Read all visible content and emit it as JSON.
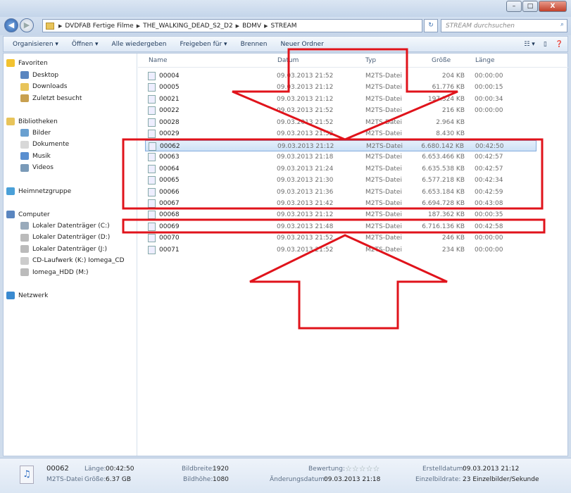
{
  "window": {
    "minimize": "–",
    "maximize": "□",
    "close": "X"
  },
  "address": {
    "crumbs": [
      "DVDFAB Fertige Filme",
      "THE_WALKING_DEAD_S2_D2",
      "BDMV",
      "STREAM"
    ],
    "search_placeholder": "STREAM durchsuchen"
  },
  "toolbar": {
    "organize": "Organisieren ▾",
    "open": "Öffnen ▾",
    "play_all": "Alle wiedergeben",
    "share": "Freigeben für ▾",
    "burn": "Brennen",
    "new_folder": "Neuer Ordner"
  },
  "sidebar": {
    "favorites": "Favoriten",
    "fav_items": [
      "Desktop",
      "Downloads",
      "Zuletzt besucht"
    ],
    "libraries": "Bibliotheken",
    "lib_items": [
      "Bilder",
      "Dokumente",
      "Musik",
      "Videos"
    ],
    "homegroup": "Heimnetzgruppe",
    "computer": "Computer",
    "drives": [
      "Lokaler Datenträger (C:)",
      "Lokaler Datenträger (D:)",
      "Lokaler Datenträger (J:)",
      "CD-Laufwerk (K:) Iomega_CD",
      "Iomega_HDD (M:)"
    ],
    "network": "Netzwerk"
  },
  "columns": [
    "Name",
    "Datum",
    "Typ",
    "Größe",
    "Länge"
  ],
  "files": [
    {
      "name": "00004",
      "date": "09.03.2013 21:52",
      "type": "M2TS-Datei",
      "size": "204 KB",
      "length": "00:00:00"
    },
    {
      "name": "00005",
      "date": "09.03.2013 21:12",
      "type": "M2TS-Datei",
      "size": "61.776 KB",
      "length": "00:00:15"
    },
    {
      "name": "00021",
      "date": "09.03.2013 21:12",
      "type": "M2TS-Datei",
      "size": "197.324 KB",
      "length": "00:00:34"
    },
    {
      "name": "00022",
      "date": "09.03.2013 21:52",
      "type": "M2TS-Datei",
      "size": "216 KB",
      "length": "00:00:00"
    },
    {
      "name": "00028",
      "date": "09.03.2013 21:52",
      "type": "M2TS-Datei",
      "size": "2.964 KB",
      "length": ""
    },
    {
      "name": "00029",
      "date": "09.03.2013 21:52",
      "type": "M2TS-Datei",
      "size": "8.430 KB",
      "length": ""
    },
    {
      "name": "00062",
      "date": "09.03.2013 21:12",
      "type": "M2TS-Datei",
      "size": "6.680.142 KB",
      "length": "00:42:50",
      "selected": true
    },
    {
      "name": "00063",
      "date": "09.03.2013 21:18",
      "type": "M2TS-Datei",
      "size": "6.653.466 KB",
      "length": "00:42:57"
    },
    {
      "name": "00064",
      "date": "09.03.2013 21:24",
      "type": "M2TS-Datei",
      "size": "6.635.538 KB",
      "length": "00:42:57"
    },
    {
      "name": "00065",
      "date": "09.03.2013 21:30",
      "type": "M2TS-Datei",
      "size": "6.577.218 KB",
      "length": "00:42:34"
    },
    {
      "name": "00066",
      "date": "09.03.2013 21:36",
      "type": "M2TS-Datei",
      "size": "6.653.184 KB",
      "length": "00:42:59"
    },
    {
      "name": "00067",
      "date": "09.03.2013 21:42",
      "type": "M2TS-Datei",
      "size": "6.694.728 KB",
      "length": "00:43:08"
    },
    {
      "name": "00068",
      "date": "09.03.2013 21:12",
      "type": "M2TS-Datei",
      "size": "187.362 KB",
      "length": "00:00:35"
    },
    {
      "name": "00069",
      "date": "09.03.2013 21:48",
      "type": "M2TS-Datei",
      "size": "6.716.136 KB",
      "length": "00:42:58"
    },
    {
      "name": "00070",
      "date": "09.03.2013 21:52",
      "type": "M2TS-Datei",
      "size": "246 KB",
      "length": "00:00:00"
    },
    {
      "name": "00071",
      "date": "09.03.2013 21:52",
      "type": "M2TS-Datei",
      "size": "234 KB",
      "length": "00:00:00"
    }
  ],
  "details": {
    "name": "00062",
    "type": "M2TS-Datei",
    "length_label": "Länge:",
    "length": "00:42:50",
    "size_label": "Größe:",
    "size": "6.37 GB",
    "width_label": "Bildbreite:",
    "width": "1920",
    "height_label": "Bildhöhe:",
    "height": "1080",
    "rating_label": "Bewertung:",
    "rating_stars": "☆☆☆☆☆",
    "modified_label": "Änderungsdatum:",
    "modified": "09.03.2013 21:18",
    "created_label": "Erstelldatum:",
    "created": "09.03.2013 21:12",
    "framerate_label": "Einzelbildrate:",
    "framerate": "23 Einzelbilder/Sekunde"
  },
  "annotation_color": "#e0131b"
}
